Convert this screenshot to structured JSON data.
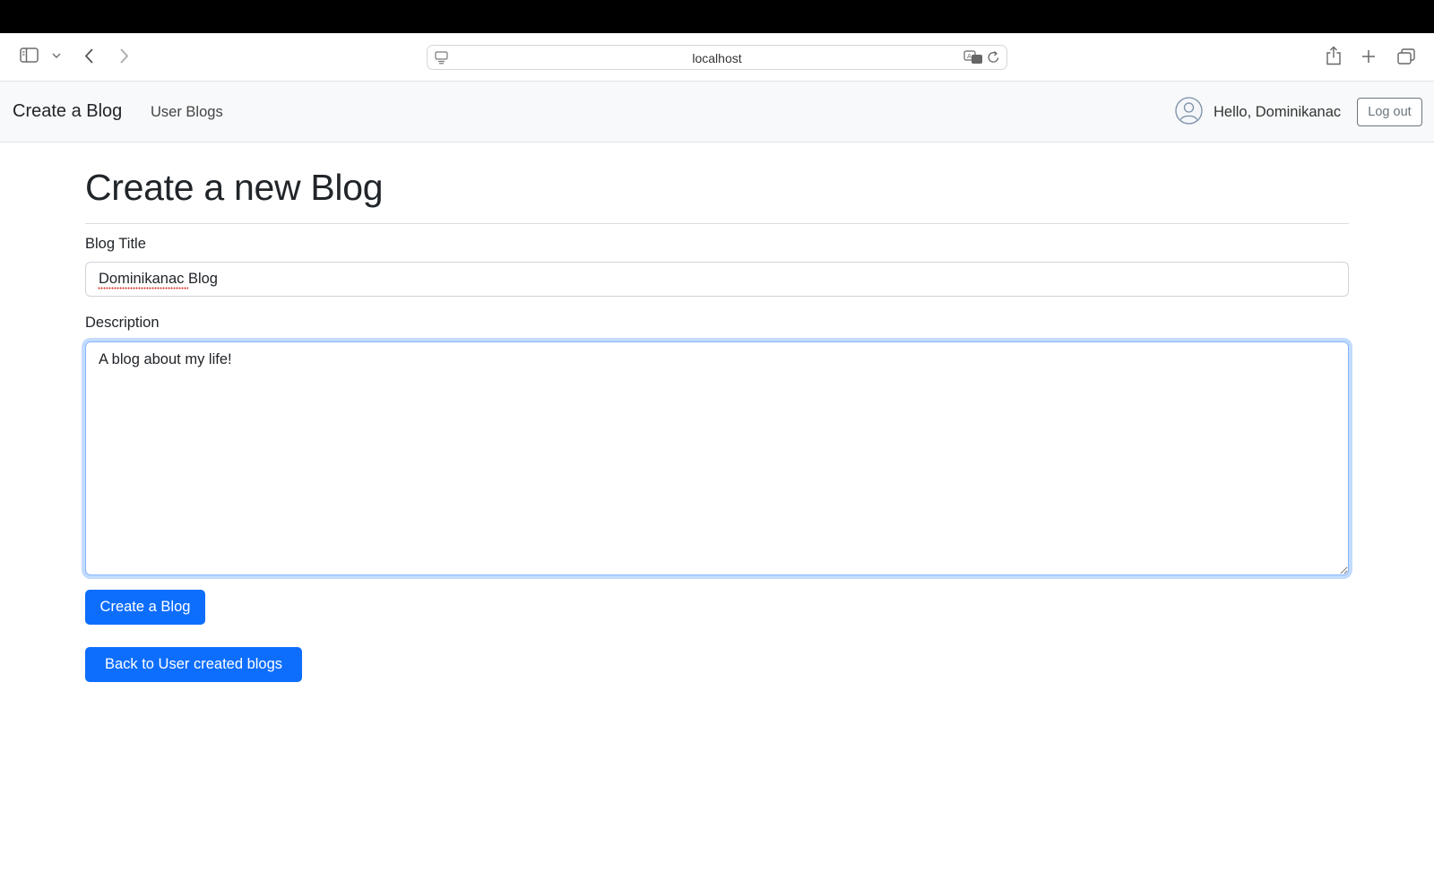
{
  "browser": {
    "url": "localhost",
    "icons": [
      "sidebar-icon",
      "chevron-down-icon",
      "back-arrow-icon",
      "forward-arrow-icon",
      "page-icon",
      "translate-icon",
      "reload-icon",
      "share-icon",
      "plus-icon",
      "tabs-icon"
    ]
  },
  "nav": {
    "brand": "Create a Blog",
    "links": [
      {
        "label": "User Blogs"
      }
    ],
    "greeting": "Hello, Dominikanac",
    "logout_label": "Log out",
    "avatar_icon": "user-avatar-icon"
  },
  "form": {
    "heading": "Create a new Blog",
    "title_label": "Blog Title",
    "title_value": "Dominikanac Blog",
    "description_label": "Description",
    "description_value": "A blog about my life!",
    "submit_label": "Create a Blog",
    "back_label": "Back to User created blogs"
  },
  "colors": {
    "primary": "#0d6efd",
    "navbar_bg": "#f8f9fa",
    "focus_ring": "#86b7fe"
  }
}
